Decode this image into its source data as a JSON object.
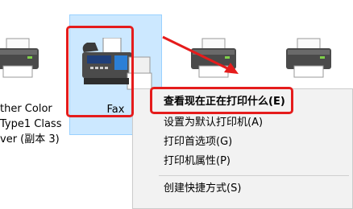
{
  "devices": [
    {
      "label": "ther Color\nType1 Class\nver (副本 3)"
    },
    {
      "label": "Fax"
    },
    {
      "label": ""
    },
    {
      "label": ""
    }
  ],
  "context_menu": {
    "items": [
      {
        "label": "查看现在正在打印什么(E)"
      },
      {
        "label": "设置为默认打印机(A)"
      },
      {
        "label": "打印首选项(G)"
      },
      {
        "label": "打印机属性(P)"
      },
      {
        "label": "创建快捷方式(S)"
      }
    ]
  },
  "colors": {
    "selection_bg": "#cce8ff",
    "annotation_red": "#e51c1c",
    "menu_bg": "#f2f2f2"
  }
}
